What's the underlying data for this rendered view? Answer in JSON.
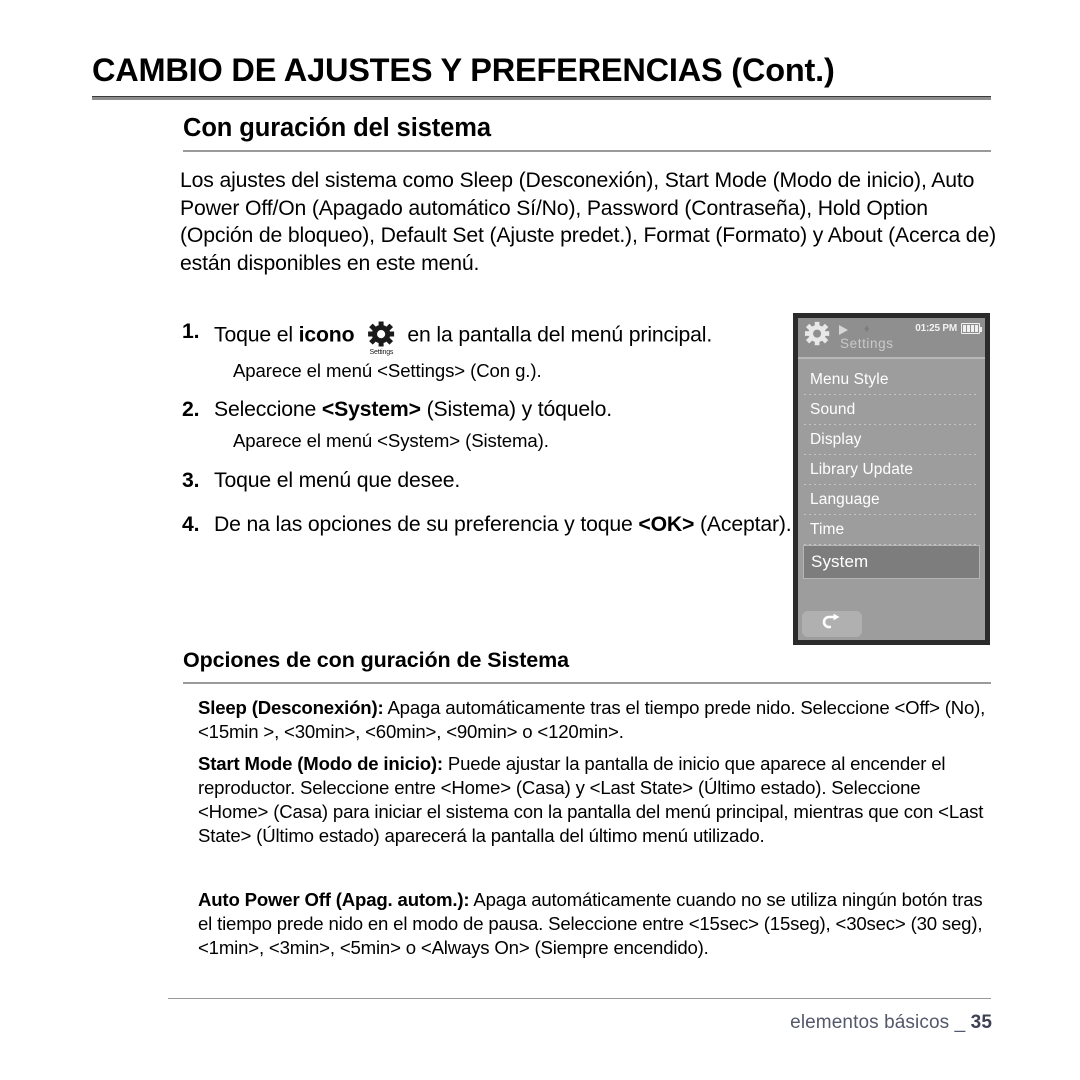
{
  "chapter": {
    "title": "CAMBIO DE AJUSTES Y PREFERENCIAS (Cont.)"
  },
  "section": {
    "heading": "Con guración del sistema",
    "intro": "Los ajustes del sistema como Sleep (Desconexión), Start Mode (Modo de inicio), Auto Power Off/On (Apagado automático Sí/No), Password (Contraseña), Hold Option (Opción de bloqueo), Default Set (Ajuste predet.), Format (Formato) y About (Acerca de) están disponibles en este menú."
  },
  "steps": [
    {
      "num": "1.",
      "text_before": "Toque el ",
      "bold": "icono",
      "icon_caption": "Settings",
      "text_after": "en la pantalla del menú principal.",
      "sub": "Aparece el menú <Settings> (Con g.)."
    },
    {
      "num": "2.",
      "text_before": "Seleccione ",
      "bold": "<System>",
      "text_after": " (Sistema) y tóquelo.",
      "sub": "Aparece el menú <System> (Sistema)."
    },
    {
      "num": "3.",
      "text_before": "Toque el menú que desee.",
      "bold": "",
      "text_after": "",
      "sub": ""
    },
    {
      "num": "4.",
      "text_before": "De na las opciones de su preferencia y toque ",
      "bold": "<OK>",
      "text_after": " (Aceptar).",
      "sub": ""
    }
  ],
  "device": {
    "status": {
      "title": "Settings",
      "time": "01:25 PM",
      "gear_icon": "gear-icon",
      "play_icon": "play-icon",
      "bluetooth_icon": "bluetooth-icon",
      "battery_icon": "battery-icon"
    },
    "menu_items": [
      {
        "label": "Menu Style",
        "selected": false
      },
      {
        "label": "Sound",
        "selected": false
      },
      {
        "label": "Display",
        "selected": false
      },
      {
        "label": "Library Update",
        "selected": false
      },
      {
        "label": "Language",
        "selected": false
      },
      {
        "label": "Time",
        "selected": false
      },
      {
        "label": "System",
        "selected": true
      }
    ],
    "back_icon": "back-arrow-icon"
  },
  "options": {
    "heading": "Opciones de con guración de Sistema",
    "items": [
      {
        "title": "Sleep (Desconexión):",
        "body": " Apaga automáticamente tras el tiempo prede nido. Seleccione <Off> (No), <15min >, <30min>, <60min>, <90min> o <120min>."
      },
      {
        "title": "Start Mode (Modo de inicio):",
        "body": " Puede ajustar la pantalla de inicio que aparece al encender el reproductor. Seleccione entre <Home> (Casa) y <Last State> (Último estado). Seleccione <Home> (Casa) para iniciar el sistema con la pantalla del menú principal, mientras que con <Last State> (Último estado) aparecerá la pantalla del último menú utilizado."
      },
      {
        "title": "Auto Power Off (Apag. autom.):",
        "body": " Apaga automáticamente cuando no se utiliza ningún botón tras el tiempo prede nido en el modo de pausa. Seleccione entre <15sec> (15seg), <30sec> (30 seg), <1min>, <3min>, <5min>  o <Always On> (Siempre encendido)."
      }
    ]
  },
  "footer": {
    "label": "elementos básicos _",
    "page": "35"
  },
  "colors": {
    "rule": "#9a9a9a",
    "screen_bg": "#9d9d9d",
    "screen_border": "#2b2b2b",
    "status_bg": "#8f8f8f",
    "selected_bg": "#7d7d7d",
    "footer_text": "#53586b"
  }
}
